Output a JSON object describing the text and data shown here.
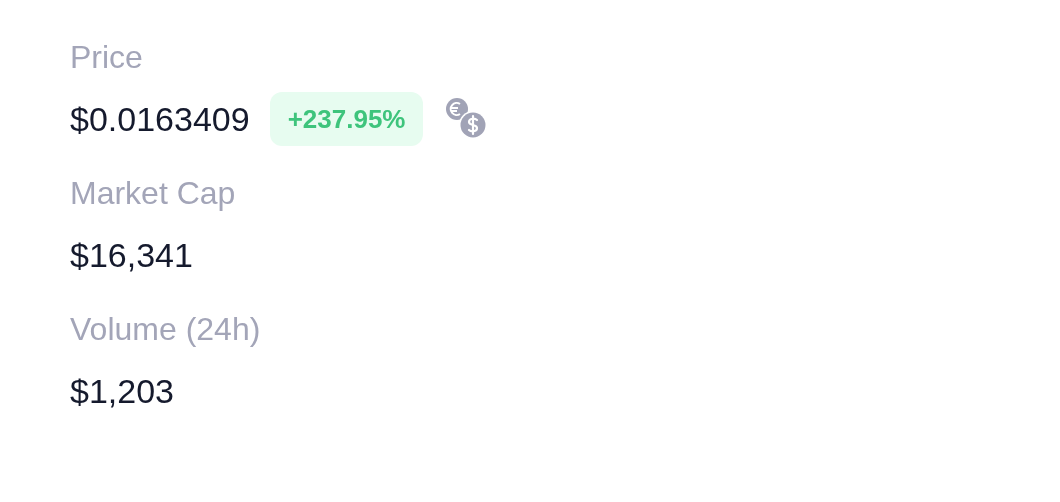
{
  "stats": [
    {
      "label": "Price",
      "value": "$0.0163409",
      "change": "+237.95%",
      "currency_toggle": true
    },
    {
      "label": "Market Cap",
      "value": "$16,341"
    },
    {
      "label": "Volume (24h)",
      "value": "$1,203"
    }
  ]
}
